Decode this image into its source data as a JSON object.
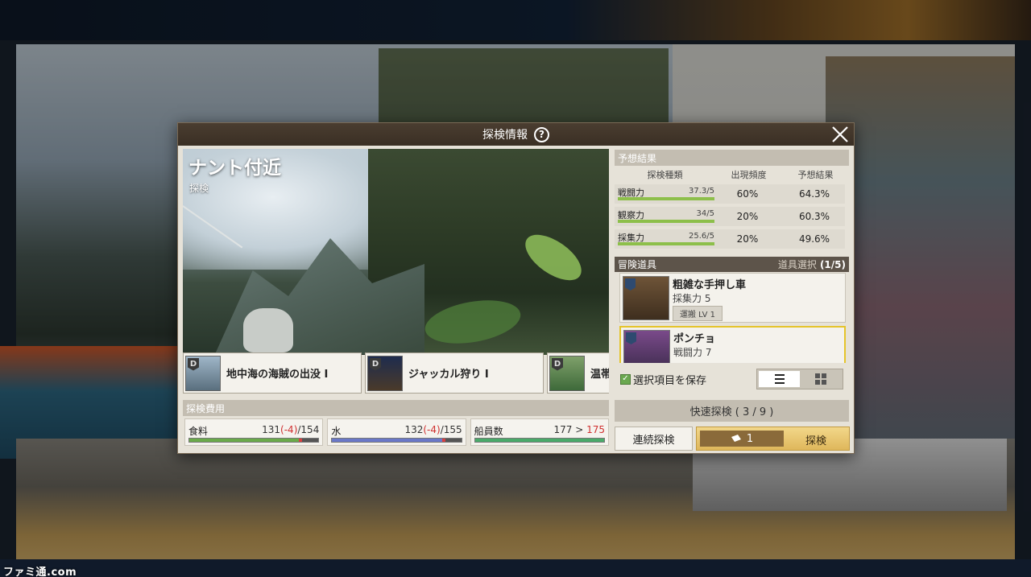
{
  "dialog": {
    "title": "探検情報",
    "help_icon": "question-circle-icon",
    "close_icon": "close-x-icon"
  },
  "scene": {
    "location": "ナント付近",
    "type": "探検"
  },
  "quests": [
    {
      "rank": "D",
      "label": "地中海の海賊の出没 I"
    },
    {
      "rank": "D",
      "label": "ジャッカル狩り I"
    },
    {
      "rank": "D",
      "label": "温帯"
    }
  ],
  "cost": {
    "header": "探検費用",
    "food": {
      "label": "食料",
      "current": "131",
      "delta": "(-4)",
      "max": "/154",
      "fraction": 0.85,
      "used_fraction": 0.026,
      "color": "#6aaa4a"
    },
    "water": {
      "label": "水",
      "current": "132",
      "delta": "(-4)",
      "max": "/155",
      "fraction": 0.85,
      "used_fraction": 0.026,
      "color": "#6a78c8"
    },
    "crew": {
      "label": "船員数",
      "text": "177 >",
      "next": "175",
      "fraction": 1.0,
      "color": "#4aaa6a"
    }
  },
  "prediction": {
    "header": "予想結果",
    "columns": [
      "探検種類",
      "出現頻度",
      "予想結果"
    ],
    "rows": [
      {
        "name": "戦闘力",
        "score": "37.3/5",
        "freq": "60%",
        "result": "64.3%"
      },
      {
        "name": "観察力",
        "score": "34/5",
        "freq": "20%",
        "result": "60.3%"
      },
      {
        "name": "採集力",
        "score": "25.6/5",
        "freq": "20%",
        "result": "49.6%"
      }
    ]
  },
  "items": {
    "header": "冒険道具",
    "select_label": "道具選択",
    "select_count": "(1/5)",
    "list": [
      {
        "name": "粗雑な手押し車",
        "stat": "採集力 5",
        "tag": "運搬 LV 1"
      },
      {
        "name": "ポンチョ",
        "stat": "戦闘力 7",
        "tag": ""
      }
    ]
  },
  "save_option": {
    "label": "選択項目を保存",
    "checked": true
  },
  "view_toggle": {
    "list_icon": "list-view-icon",
    "grid_icon": "grid-view-icon",
    "active": "list"
  },
  "quick": {
    "label": "快速探検 ( 3 / 9 )"
  },
  "buttons": {
    "continuous": "連続探検",
    "ticket_icon": "ticket-icon",
    "ticket_count": "1",
    "explore": "探検"
  },
  "watermark": "ファミ通.com"
}
